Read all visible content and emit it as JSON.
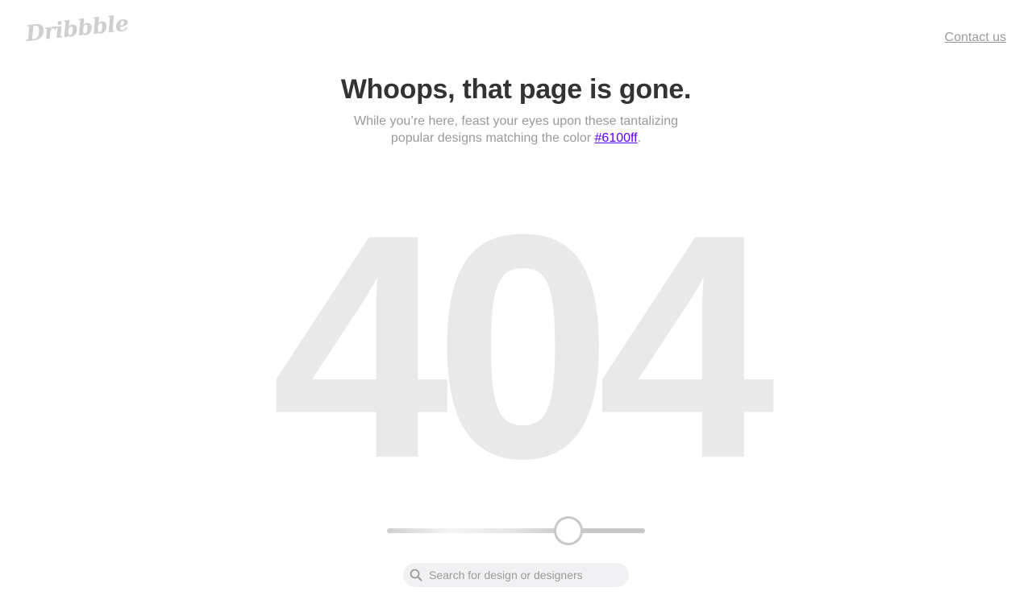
{
  "header": {
    "logo_text": "Dribbble",
    "contact_label": "Contact us"
  },
  "message": {
    "title": "Whoops, that page is gone.",
    "subtitle_before": "While you’re here, feast your eyes upon these tantalizing popular designs matching the color ",
    "color_link": "#6100ff",
    "subtitle_after": "."
  },
  "error_code": "404",
  "color_slider": {
    "value_percent": 70,
    "accent_color": "#6100ff"
  },
  "search": {
    "placeholder": "Search for design or designers",
    "value": "",
    "icon": "search-icon"
  },
  "colors": {
    "title": "#333333",
    "muted_text": "#9a9a9a",
    "big_404": "#e9e9e9",
    "link": "#6100ff",
    "search_bg": "#f1f1f3"
  }
}
